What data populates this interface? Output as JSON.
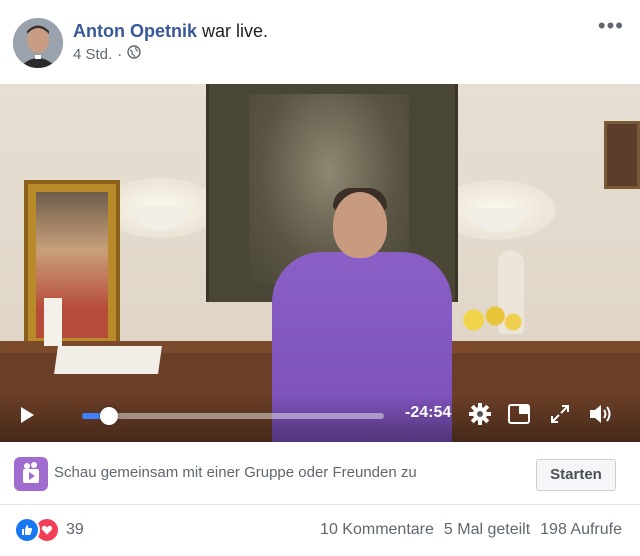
{
  "post": {
    "author": "Anton Opetnik",
    "action": "war live.",
    "time": "4 Std.",
    "separator": "·",
    "privacy_icon": "globe-icon",
    "more_icon": "more-options-icon",
    "more_label": "•••"
  },
  "video": {
    "time_remaining": "-24:54",
    "progress": 0.09,
    "icons": [
      "play-icon",
      "gear-icon",
      "picture-in-picture-icon",
      "fullscreen-icon",
      "volume-icon"
    ]
  },
  "watch_party": {
    "icon": "watch-party-icon",
    "text": "Schau gemeinsam mit einer Gruppe oder Freunden zu",
    "button_label": "Starten"
  },
  "engagement": {
    "reactions": [
      "like",
      "love"
    ],
    "reaction_count": "39",
    "comments": "10 Kommentare",
    "shares": "5 Mal geteilt",
    "views": "198 Aufrufe"
  },
  "colors": {
    "author_link": "#385898",
    "accent": "#4080ff",
    "like": "#1877f2",
    "love": "#f33e58",
    "watch_party": "#a06ccf"
  }
}
